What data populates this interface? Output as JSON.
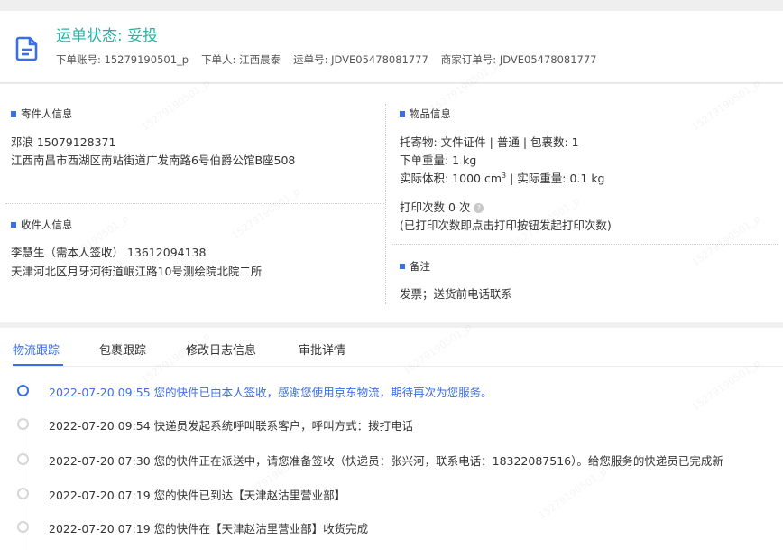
{
  "header": {
    "status": "运单状态: 妥投",
    "account": "下单账号: 15279190501_p",
    "orderer_label": "下单人:",
    "orderer_name": "江西晨泰",
    "waybill": "运单号: JDVE05478081777",
    "merchant_order": "商家订单号: JDVE05478081777"
  },
  "sender": {
    "title": "寄件人信息",
    "name_phone": "邓浪  15079128371",
    "address": "江西南昌市西湖区南站街道广发南路6号伯爵公馆B座508"
  },
  "receiver": {
    "title": "收件人信息",
    "name_phone": "李慧生（需本人签收）  13612094138",
    "address": "天津河北区月牙河街道岷江路10号测绘院北院二所"
  },
  "goods": {
    "title": "物品信息",
    "line1": "托寄物: 文件证件 | 普通 | 包裹数:  1",
    "line2": "下单重量:  1 kg",
    "line3_a": "实际体积:   1000 cm",
    "line3_sup": "3",
    "line3_b": " | 实际重量:  0.1 kg",
    "print_count": "打印次数   0 次",
    "print_note": "(已打印次数即点击打印按钮发起打印次数)"
  },
  "remark": {
    "title": "备注",
    "text": "发票；送货前电话联系"
  },
  "tabs": [
    "物流跟踪",
    "包裹跟踪",
    "修改日志信息",
    "审批详情"
  ],
  "events": [
    "2022-07-20 09:55 您的快件已由本人签收，感谢您使用京东物流，期待再次为您服务。",
    "2022-07-20 09:54 快递员发起系统呼叫联系客户，呼叫方式：拨打电话",
    "2022-07-20 07:30 您的快件正在派送中，请您准备签收（快递员：张兴河，联系电话：18322087516）。给您服务的快递员已完成新",
    "2022-07-20 07:19 您的快件已到达【天津赵沽里营业部】",
    "2022-07-20 07:19 您的快件在【天津赵沽里营业部】收货完成"
  ],
  "watermark": "15279190501_p",
  "colors": {
    "accent": "#3a6fe8",
    "status": "#26b3a6"
  }
}
